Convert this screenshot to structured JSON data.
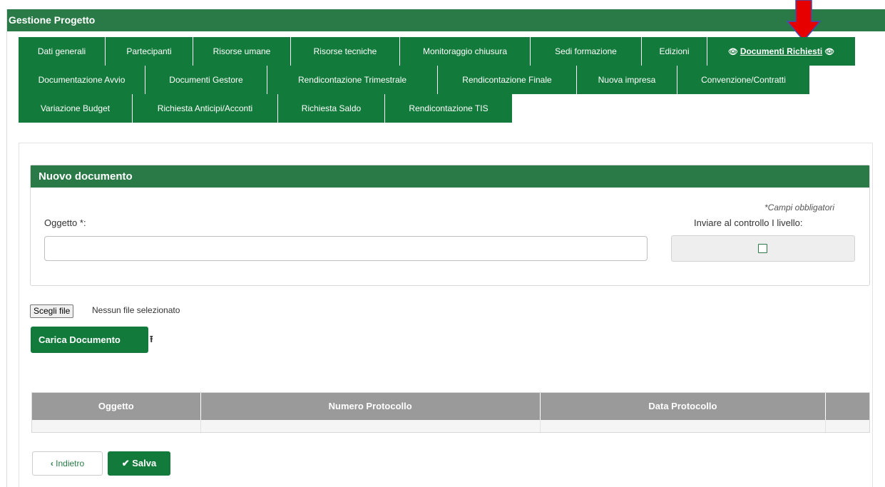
{
  "header": {
    "title": "Gestione Progetto"
  },
  "tabs": {
    "row1": [
      {
        "label": "Dati generali"
      },
      {
        "label": "Partecipanti"
      },
      {
        "label": "Risorse umane"
      },
      {
        "label": "Risorse tecniche"
      },
      {
        "label": "Monitoraggio chiusura"
      },
      {
        "label": "Sedi formazione"
      },
      {
        "label": "Edizioni"
      },
      {
        "label": "Documenti Richiesti",
        "active": true,
        "icon": "eye-icon"
      }
    ],
    "row2": [
      {
        "label": "Documentazione Avvio"
      },
      {
        "label": "Documenti Gestore"
      },
      {
        "label": "Rendicontazione Trimestrale"
      },
      {
        "label": "Rendicontazione Finale"
      },
      {
        "label": "Nuova impresa"
      },
      {
        "label": "Convenzione/Contratti"
      }
    ],
    "row3": [
      {
        "label": "Variazione Budget"
      },
      {
        "label": "Richiesta Anticipi/Acconti"
      },
      {
        "label": "Richiesta Saldo"
      },
      {
        "label": "Rendicontazione TIS"
      }
    ]
  },
  "form": {
    "panel_title": "Nuovo documento",
    "required_note": "Campi obbligatori",
    "required_mark": "*",
    "oggetto_label": "Oggetto ",
    "oggetto_suffix": ":",
    "oggetto_value": "",
    "send_control_label": "Inviare al controllo I livello:",
    "send_control_checked": false
  },
  "file": {
    "choose_label": "Scegli file",
    "status": "Nessun file selezionato",
    "upload_label": "Carica Documento"
  },
  "table": {
    "columns": [
      "Oggetto",
      "Numero Protocollo",
      "Data Protocollo",
      ""
    ],
    "rows": [
      [
        "",
        "",
        "",
        ""
      ]
    ]
  },
  "footer": {
    "back_label": "Indietro",
    "save_label": "Salva"
  },
  "colors": {
    "primary_green": "#127a3a",
    "header_green": "#2a7a47",
    "table_header_grey": "#9a9a9a",
    "arrow_red": "#e60000",
    "arrow_outline": "#3b4fb5"
  }
}
